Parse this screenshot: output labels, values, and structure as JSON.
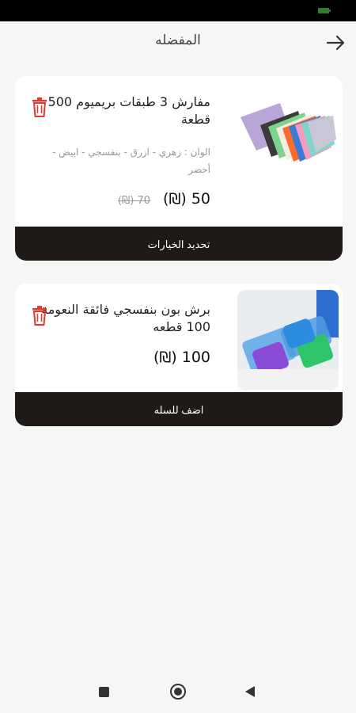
{
  "header": {
    "title": "المفضله"
  },
  "favorites": [
    {
      "title": "مفارش 3 طبقات بريميوم 500 قطعة",
      "options": "الوان : زهري - ازرق - بنفسجي - ابيض - أخضر",
      "price": "50 (₪)",
      "old_price": "70 (₪)",
      "action_label": "تحديد الخيارات"
    },
    {
      "title": "برش بون بنفسجي فائقة النعومة 100 قطعه",
      "price": "100 (₪)",
      "action_label": "اضف للسله"
    }
  ],
  "colors": {
    "button_bg": "#1f1a18",
    "trash_red": "#e03a32",
    "page_bg": "#f6f6f6"
  }
}
